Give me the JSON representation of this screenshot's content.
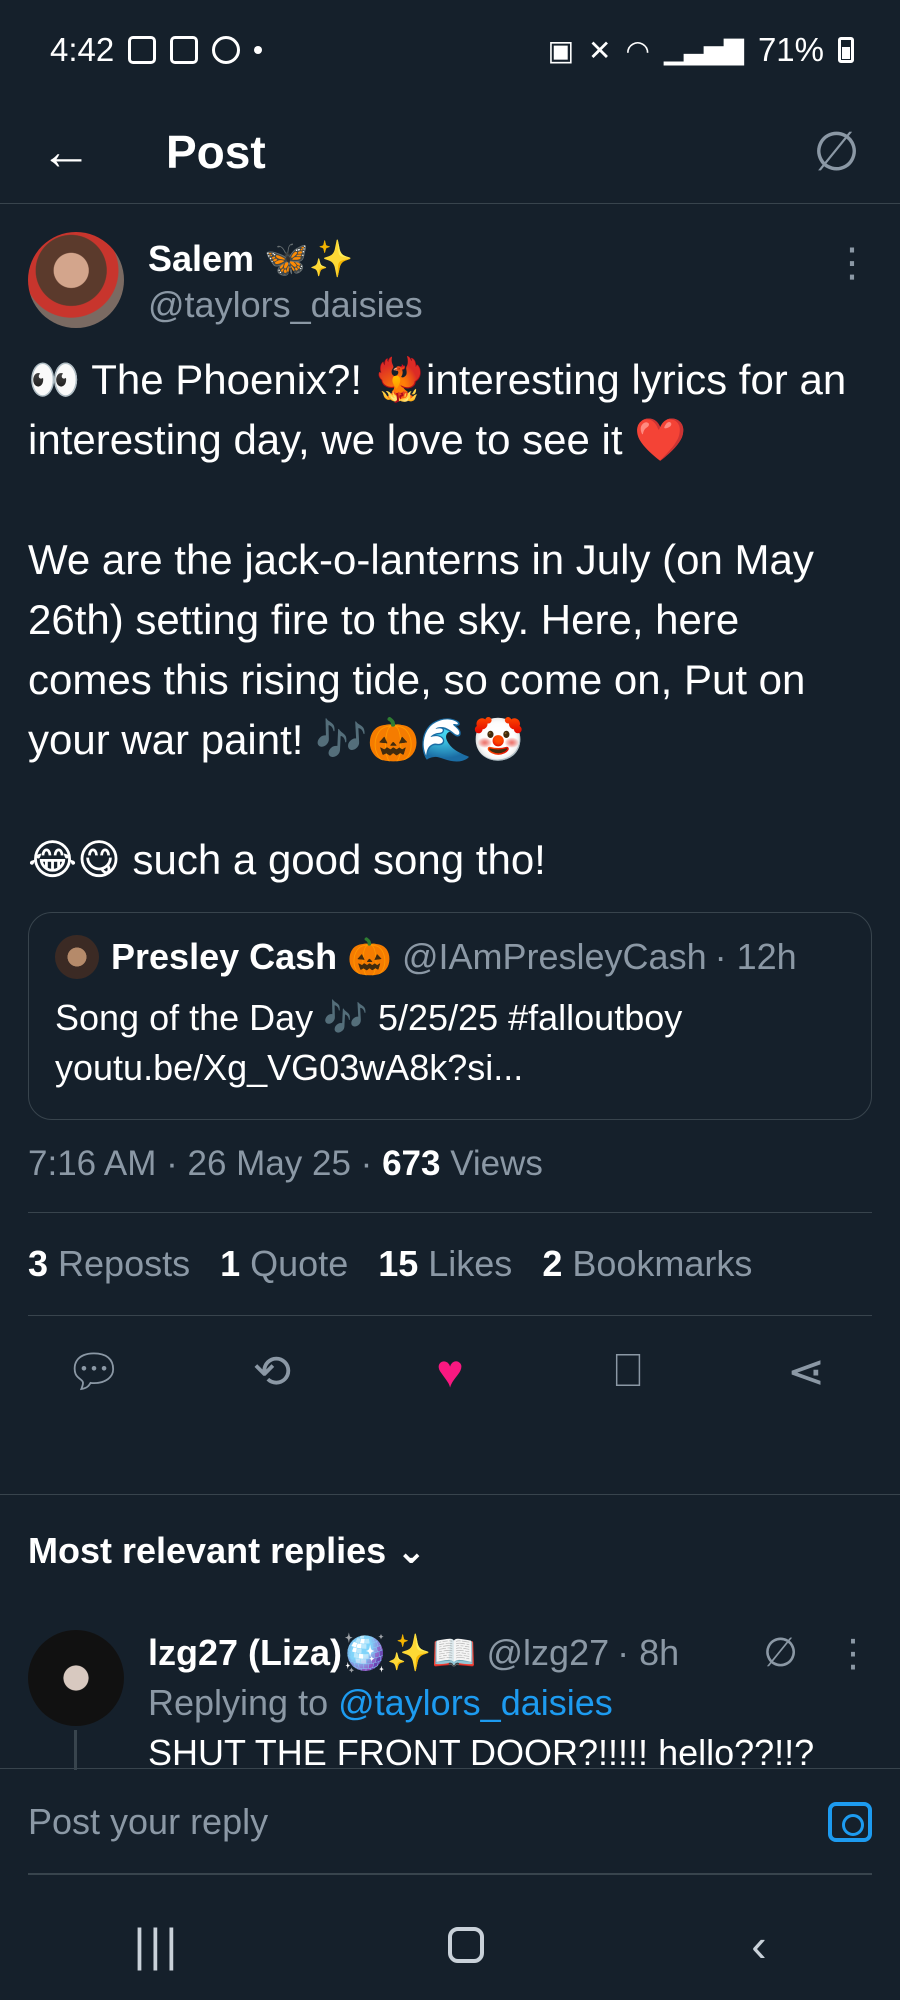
{
  "status_bar": {
    "time": "4:42",
    "battery": "71%"
  },
  "header": {
    "title": "Post"
  },
  "post": {
    "display_name": "Salem 🦋✨",
    "handle": "@taylors_daisies",
    "text": "👀 The Phoenix?! 🐦‍🔥interesting lyrics for an interesting day, we love to see it ❤️\n\nWe are the jack-o-lanterns in July (on May 26th) setting fire to the sky. Here, here comes this rising tide, so come on, Put on your war paint! 🎶🎃🌊🤡\n\n😂😋 such a good song tho!",
    "quote": {
      "display_name": "Presley Cash 🎃",
      "handle": "@IAmPresleyCash",
      "time": "· 12h",
      "text": "Song of the Day 🎶 5/25/25 #falloutboy\nyoutu.be/Xg_VG03wA8k?si..."
    },
    "timestamp": "7:16 AM · 26 May 25 · ",
    "views_count": "673",
    "views_label": " Views",
    "stats": [
      {
        "num": "3",
        "label": " Reposts"
      },
      {
        "num": "1",
        "label": " Quote"
      },
      {
        "num": "15",
        "label": " Likes"
      },
      {
        "num": "2",
        "label": " Bookmarks"
      }
    ]
  },
  "replies": {
    "heading": "Most relevant replies ⌄",
    "first": {
      "display_name": "lzg27 (Liza)🪩✨📖",
      "handle": "@lzg27",
      "time": "· 8h",
      "replying_label": "Replying to ",
      "replying_handle": "@taylors_daisies",
      "text": "SHUT THE FRONT DOOR?!!!!! hello??!!?"
    }
  },
  "composer": {
    "placeholder": "Post your reply"
  },
  "icons": {
    "back": "arrow-left-icon",
    "grok": "empty-set-icon",
    "reply": "comment-icon",
    "repost": "repost-icon",
    "like": "heart-icon",
    "bookmark": "bookmark-icon",
    "share": "share-icon",
    "camera": "camera-icon"
  },
  "colors": {
    "background": "#15202b",
    "accent": "#1d9bf0",
    "like": "#f91880",
    "muted": "#8b98a5"
  }
}
